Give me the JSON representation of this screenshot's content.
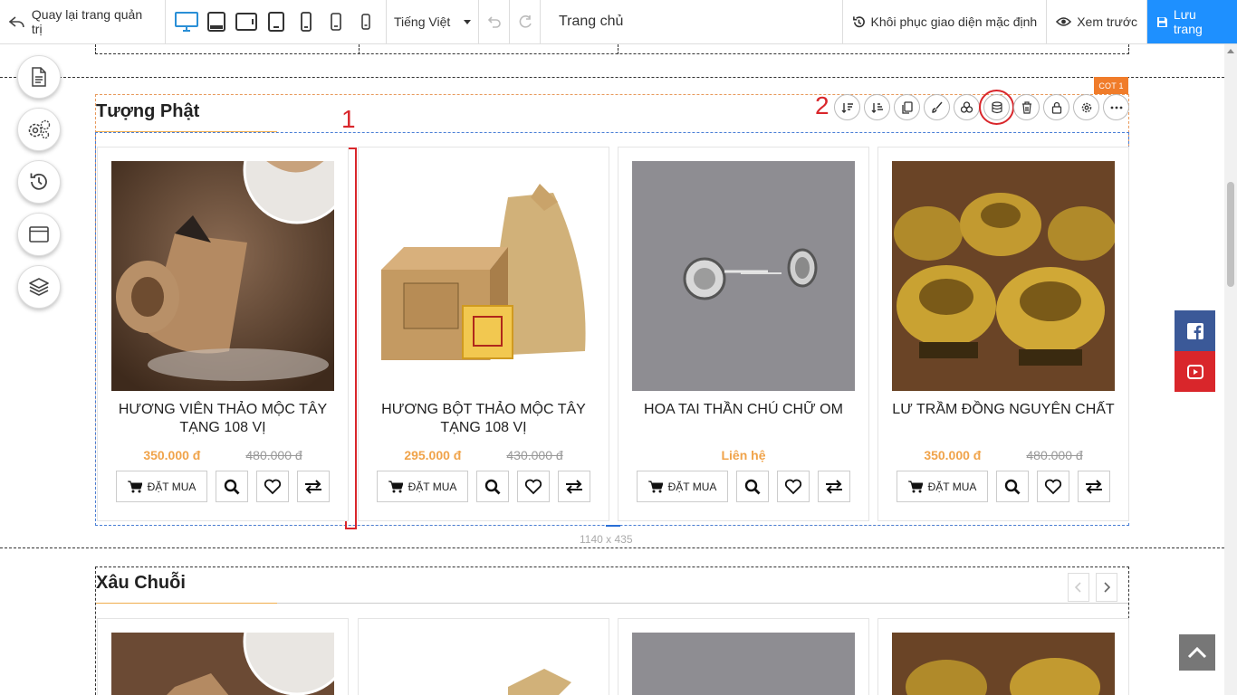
{
  "toolbar": {
    "back_label": "Quay lại trang quản trị",
    "language": "Tiếng Việt",
    "page_title": "Trang chủ",
    "restore_label": "Khôi phục giao diện mặc định",
    "preview_label": "Xem trước",
    "save_label": "Lưu trang",
    "devices": [
      "desktop-icon",
      "tablet-landscape-icon",
      "tablet-wide-icon",
      "tablet-portrait-icon",
      "phone-icon",
      "phone-small-icon",
      "phone-tiny-icon"
    ]
  },
  "sidebar": {
    "buttons": [
      "page-icon",
      "settings-icon",
      "history-icon",
      "layout-icon",
      "layers-icon"
    ]
  },
  "section1": {
    "title": "Tượng Phật",
    "column_tag": "COT 1",
    "size_label": "1140 x 435",
    "annotations": {
      "one": "1",
      "two": "2"
    },
    "controls": [
      "sort-asc-icon",
      "sort-desc-icon",
      "copy-icon",
      "brush-icon",
      "palette-icon",
      "database-icon",
      "trash-icon",
      "lock-icon",
      "gear-icon",
      "more-icon"
    ]
  },
  "products": [
    {
      "name": "HƯƠNG VIÊN THẢO MỘC TÂY TẠNG 108 VỊ",
      "price": "350.000 đ",
      "old_price": "480.000 đ",
      "buy_label": "ĐẶT MUA"
    },
    {
      "name": "HƯƠNG BỘT THẢO MỘC TÂY TẠNG 108 VỊ",
      "price": "295.000 đ",
      "old_price": "430.000 đ",
      "buy_label": "ĐẶT MUA"
    },
    {
      "name": "HOA TAI THẦN CHÚ CHỮ OM",
      "price": "Liên hệ",
      "old_price": "",
      "buy_label": "ĐẶT MUA"
    },
    {
      "name": "LƯ TRẦM ĐỒNG NGUYÊN CHẤT",
      "price": "350.000 đ",
      "old_price": "480.000 đ",
      "buy_label": "ĐẶT MUA"
    }
  ],
  "section2": {
    "title": "Xâu Chuỗi"
  },
  "colors": {
    "save_button": "#1e90ff",
    "accent_orange": "#f0a34a",
    "annotation_red": "#d9262b",
    "facebook": "#3b5998",
    "youtube": "#d9262b"
  }
}
